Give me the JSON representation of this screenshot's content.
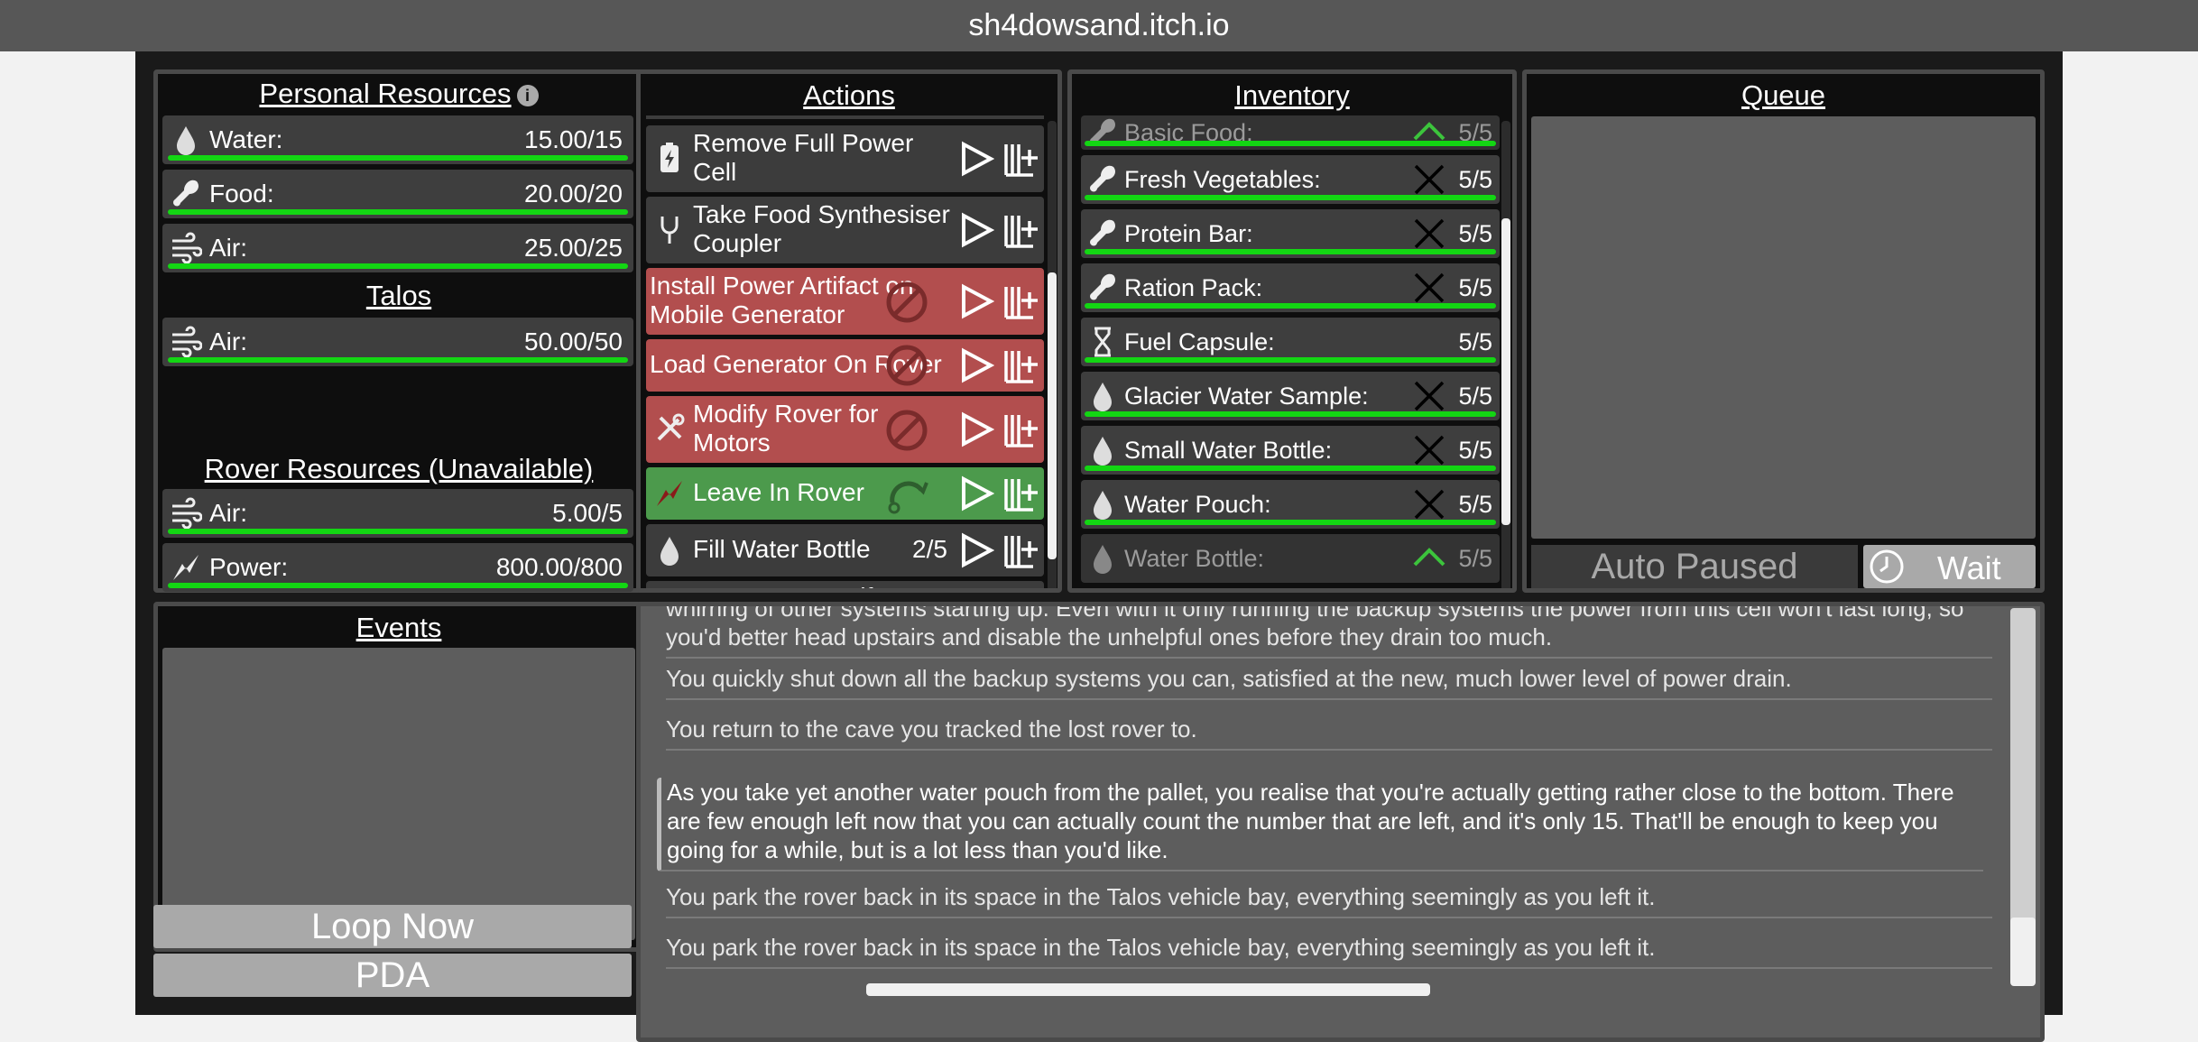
{
  "window": {
    "title": "sh4dowsand.itch.io"
  },
  "personal": {
    "title": "Personal Resources",
    "info_icon": "i",
    "items": [
      {
        "icon": "water-drop-icon",
        "label": "Water:",
        "value": "15.00/15"
      },
      {
        "icon": "food-drumstick-icon",
        "label": "Food:",
        "value": "20.00/20"
      },
      {
        "icon": "air-wind-icon",
        "label": "Air:",
        "value": "25.00/25"
      }
    ],
    "talos_title": "Talos",
    "talos_items": [
      {
        "icon": "air-wind-icon",
        "label": "Air:",
        "value": "50.00/50"
      }
    ],
    "rover_title": "Rover Resources (Unavailable)",
    "rover_items": [
      {
        "icon": "air-wind-icon",
        "label": "Air:",
        "value": "5.00/5"
      },
      {
        "icon": "power-bolt-icon",
        "label": "Power:",
        "value": "800.00/800"
      }
    ]
  },
  "actions": {
    "title": "Actions",
    "items": [
      {
        "label": "Remove Full Power Cell",
        "state": "normal",
        "icon": "power-cell-icon"
      },
      {
        "label": "Take Food Synthesiser Coupler",
        "state": "normal",
        "icon": "plug-icon"
      },
      {
        "label": "Install Power Artifact on Mobile Generator",
        "state": "blocked"
      },
      {
        "label": "Load Generator On Rover",
        "state": "blocked"
      },
      {
        "label": "Modify Rover for Motors",
        "state": "blocked",
        "icon": "wrench-icon"
      },
      {
        "label": "Leave In Rover",
        "state": "active",
        "icon": "rover-icon"
      },
      {
        "label": "Fill Water Bottle",
        "state": "normal",
        "icon": "water-drop-icon",
        "count": "2/5"
      }
    ],
    "partial_next": "Remove Power Artifact"
  },
  "inventory": {
    "title": "Inventory",
    "items": [
      {
        "label": "Basic Food:",
        "value": "5/5",
        "mark": "up",
        "dim": true,
        "icon": "food-drumstick-icon"
      },
      {
        "label": "Fresh Vegetables:",
        "value": "5/5",
        "mark": "x",
        "icon": "food-drumstick-icon"
      },
      {
        "label": "Protein Bar:",
        "value": "5/5",
        "mark": "x",
        "icon": "food-drumstick-icon"
      },
      {
        "label": "Ration Pack:",
        "value": "5/5",
        "mark": "x",
        "icon": "food-drumstick-icon"
      },
      {
        "label": "Fuel Capsule:",
        "value": "5/5",
        "mark": "none",
        "icon": "hourglass-icon"
      },
      {
        "label": "Glacier Water Sample:",
        "value": "5/5",
        "mark": "x",
        "icon": "water-drop-icon"
      },
      {
        "label": "Small Water Bottle:",
        "value": "5/5",
        "mark": "x",
        "icon": "water-drop-icon"
      },
      {
        "label": "Water Pouch:",
        "value": "5/5",
        "mark": "x",
        "icon": "water-drop-icon"
      },
      {
        "label": "Water Bottle:",
        "value": "5/5",
        "mark": "up",
        "dim": true,
        "icon": "water-drop-icon"
      }
    ]
  },
  "queue": {
    "title": "Queue",
    "auto_paused": "Auto Paused",
    "wait": "Wait"
  },
  "events": {
    "title": "Events"
  },
  "buttons": {
    "loop_now": "Loop Now",
    "pda": "PDA"
  },
  "log": {
    "lines": [
      "whirring of other systems starting up. Even with it only running the backup systems the power from this cell won't last long, so you'd better head upstairs and disable the unhelpful ones before they drain too much.",
      "You quickly shut down all the backup systems you can, satisfied at the new, much lower level of power drain.",
      "You return to the cave you tracked the lost rover to.",
      "As you take yet another water pouch from the pallet, you realise that you're actually getting rather close to the bottom. There are few enough left now that you can actually count the number that are left, and it's only 15. That'll be enough to keep you going for a while, but is a lot less than you'd like.",
      "You park the rover back in its space in the Talos vehicle bay, everything seemingly as you left it.",
      "You park the rover back in its space in the Talos vehicle bay, everything seemingly as you left it."
    ]
  },
  "colors": {
    "bar": "#13d613",
    "blocked": "#b24e4e",
    "active": "#4c9a4c"
  }
}
